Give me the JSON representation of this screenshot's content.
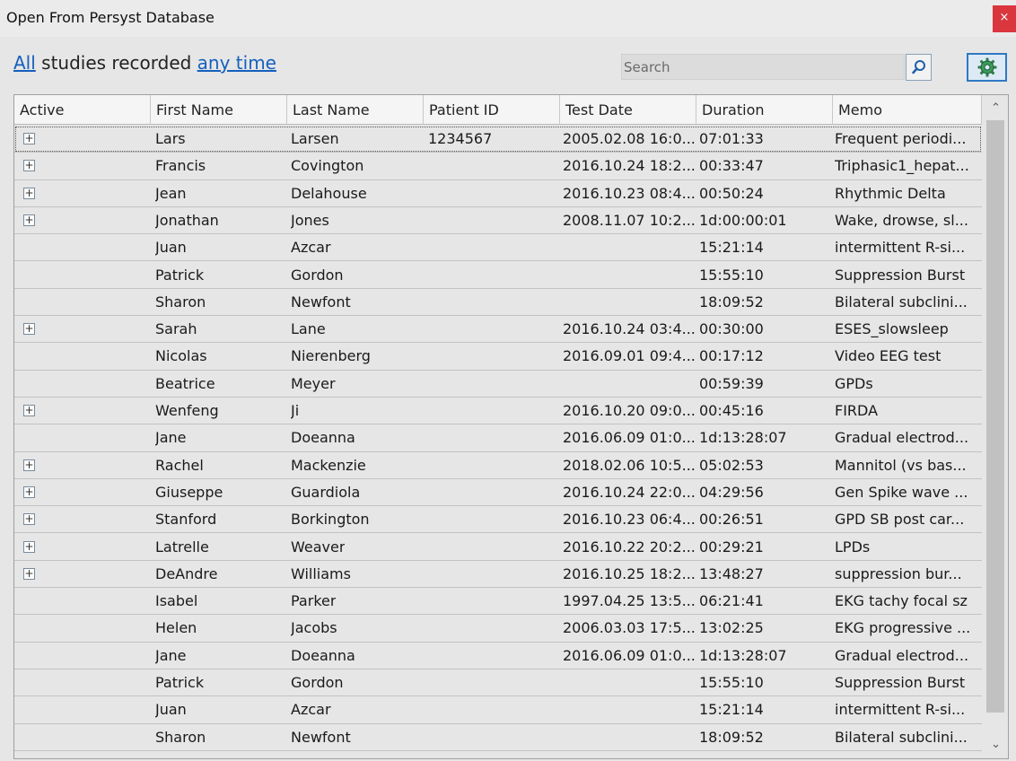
{
  "window": {
    "title": "Open From Persyst Database",
    "close_label": "×"
  },
  "filter": {
    "link_all": "All",
    "middle_text": " studies recorded ",
    "link_time": "any time"
  },
  "search": {
    "placeholder": "Search",
    "value": ""
  },
  "icons": {
    "search": "search-icon",
    "settings": "gear-icon",
    "close": "close-icon",
    "expand": "expand-plus-icon"
  },
  "colors": {
    "link": "#1560bd",
    "close_button": "#d9363e",
    "settings_border": "#2f78c4"
  },
  "table": {
    "columns": [
      "Active",
      "First Name",
      "Last Name",
      "Patient ID",
      "Test Date",
      "Duration",
      "Memo"
    ],
    "rows": [
      {
        "expand": true,
        "first": "Lars",
        "last": "Larsen",
        "pid": "1234567",
        "date": "2005.02.08  16:0...",
        "duration": "07:01:33",
        "memo": "Frequent periodi..."
      },
      {
        "expand": true,
        "first": "Francis",
        "last": "Covington",
        "pid": "",
        "date": "2016.10.24  18:2...",
        "duration": "00:33:47",
        "memo": "Triphasic1_hepat..."
      },
      {
        "expand": true,
        "first": "Jean",
        "last": "Delahouse",
        "pid": "",
        "date": "2016.10.23  08:4...",
        "duration": "00:50:24",
        "memo": "Rhythmic Delta"
      },
      {
        "expand": true,
        "first": "Jonathan",
        "last": "Jones",
        "pid": "",
        "date": "2008.11.07  10:2...",
        "duration": "1d:00:00:01",
        "memo": "Wake, drowse, sl..."
      },
      {
        "expand": false,
        "first": "Juan",
        "last": "Azcar",
        "pid": "",
        "date": "",
        "duration": "15:21:14",
        "memo": "intermittent R-si..."
      },
      {
        "expand": false,
        "first": "Patrick",
        "last": "Gordon",
        "pid": "",
        "date": "",
        "duration": "15:55:10",
        "memo": "Suppression Burst"
      },
      {
        "expand": false,
        "first": "Sharon",
        "last": "Newfont",
        "pid": "",
        "date": "",
        "duration": "18:09:52",
        "memo": "Bilateral subclini..."
      },
      {
        "expand": true,
        "first": "Sarah",
        "last": "Lane",
        "pid": "",
        "date": "2016.10.24  03:4...",
        "duration": "00:30:00",
        "memo": "ESES_slowsleep"
      },
      {
        "expand": false,
        "first": "Nicolas",
        "last": "Nierenberg",
        "pid": "",
        "date": "2016.09.01  09:4...",
        "duration": "00:17:12",
        "memo": "Video EEG test"
      },
      {
        "expand": false,
        "first": "Beatrice",
        "last": "Meyer",
        "pid": "",
        "date": "",
        "duration": "00:59:39",
        "memo": "GPDs"
      },
      {
        "expand": true,
        "first": "Wenfeng",
        "last": "Ji",
        "pid": "",
        "date": "2016.10.20  09:0...",
        "duration": "00:45:16",
        "memo": "FIRDA"
      },
      {
        "expand": false,
        "first": "Jane",
        "last": "Doeanna",
        "pid": "",
        "date": "2016.06.09  01:0...",
        "duration": "1d:13:28:07",
        "memo": "Gradual electrod..."
      },
      {
        "expand": true,
        "first": "Rachel",
        "last": "Mackenzie",
        "pid": "",
        "date": "2018.02.06  10:5...",
        "duration": "05:02:53",
        "memo": "Mannitol (vs bas..."
      },
      {
        "expand": true,
        "first": "Giuseppe",
        "last": "Guardiola",
        "pid": "",
        "date": "2016.10.24  22:0...",
        "duration": "04:29:56",
        "memo": "Gen Spike wave ..."
      },
      {
        "expand": true,
        "first": "Stanford",
        "last": "Borkington",
        "pid": "",
        "date": "2016.10.23  06:4...",
        "duration": "00:26:51",
        "memo": "GPD SB post car..."
      },
      {
        "expand": true,
        "first": "Latrelle",
        "last": "Weaver",
        "pid": "",
        "date": "2016.10.22  20:2...",
        "duration": "00:29:21",
        "memo": "LPDs"
      },
      {
        "expand": true,
        "first": "DeAndre",
        "last": "Williams",
        "pid": "",
        "date": "2016.10.25  18:2...",
        "duration": "13:48:27",
        "memo": "suppression bur..."
      },
      {
        "expand": false,
        "first": "Isabel",
        "last": "Parker",
        "pid": "",
        "date": "1997.04.25  13:5...",
        "duration": "06:21:41",
        "memo": "EKG tachy focal sz"
      },
      {
        "expand": false,
        "first": "Helen",
        "last": "Jacobs",
        "pid": "",
        "date": "2006.03.03  17:5...",
        "duration": "13:02:25",
        "memo": "EKG progressive ..."
      },
      {
        "expand": false,
        "first": "Jane",
        "last": "Doeanna",
        "pid": "",
        "date": "2016.06.09  01:0...",
        "duration": "1d:13:28:07",
        "memo": "Gradual electrod..."
      },
      {
        "expand": false,
        "first": "Patrick",
        "last": "Gordon",
        "pid": "",
        "date": "",
        "duration": "15:55:10",
        "memo": "Suppression Burst"
      },
      {
        "expand": false,
        "first": "Juan",
        "last": "Azcar",
        "pid": "",
        "date": "",
        "duration": "15:21:14",
        "memo": "intermittent R-si..."
      },
      {
        "expand": false,
        "first": "Sharon",
        "last": "Newfont",
        "pid": "",
        "date": "",
        "duration": "18:09:52",
        "memo": "Bilateral subclini..."
      }
    ]
  }
}
